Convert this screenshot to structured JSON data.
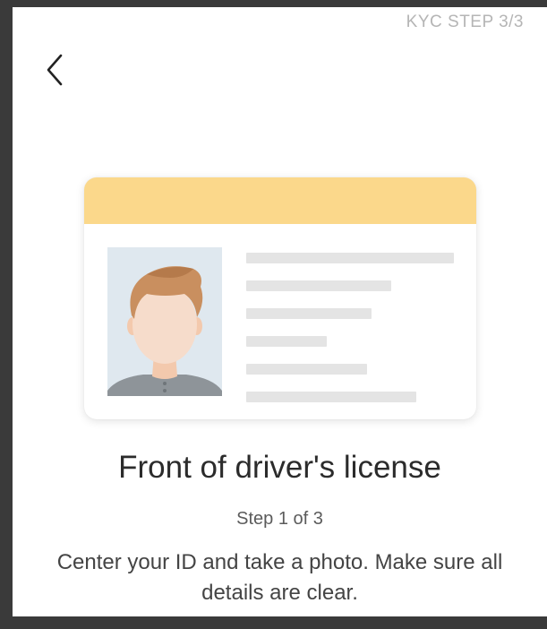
{
  "header": {
    "kyc_step": "KYC STEP 3/3"
  },
  "content": {
    "title": "Front of driver's license",
    "step": "Step 1 of 3",
    "description": "Center your ID and take a photo. Make sure all details are clear."
  },
  "colors": {
    "card_header": "#fbd88b",
    "photo_bg": "#dfe8ef",
    "placeholder_line": "#e4e4e4"
  },
  "icons": {
    "back": "chevron-left-icon"
  }
}
